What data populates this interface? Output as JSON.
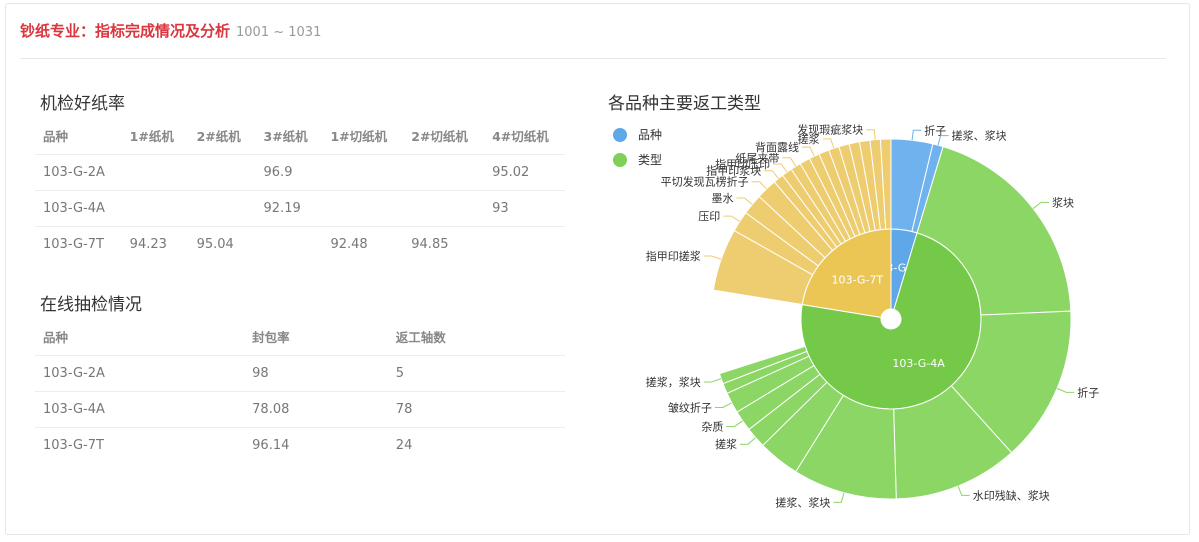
{
  "header": {
    "title": "钞纸专业：指标完成情况及分析",
    "range": "1001 ~ 1031"
  },
  "machine_table": {
    "title": "机检好纸率",
    "columns": [
      "品种",
      "1#纸机",
      "2#纸机",
      "3#纸机",
      "1#切纸机",
      "2#切纸机",
      "4#切纸机"
    ],
    "rows": [
      [
        "103-G-2A",
        "",
        "",
        "96.9",
        "",
        "",
        "95.02"
      ],
      [
        "103-G-4A",
        "",
        "",
        "92.19",
        "",
        "",
        "93"
      ],
      [
        "103-G-7T",
        "94.23",
        "95.04",
        "",
        "92.48",
        "94.85",
        ""
      ]
    ]
  },
  "online_table": {
    "title": "在线抽检情况",
    "columns": [
      "品种",
      "封包率",
      "返工轴数"
    ],
    "rows": [
      [
        "103-G-2A",
        "98",
        "5"
      ],
      [
        "103-G-4A",
        "78.08",
        "78"
      ],
      [
        "103-G-7T",
        "96.14",
        "24"
      ]
    ]
  },
  "chart": {
    "title": "各品种主要返工类型",
    "legend": [
      {
        "label": "品种",
        "color": "#5ea8ea"
      },
      {
        "label": "类型",
        "color": "#7ed05a"
      }
    ]
  },
  "chart_data": {
    "type": "sunburst",
    "title": "各品种主要返工类型",
    "rings": [
      {
        "name": "103-G-2A",
        "value": 5,
        "color": "#5ea8ea",
        "childColor": "#6fb2ee",
        "children": [
          {
            "name": "折子",
            "value": 4
          },
          {
            "name": "搓浆、浆块",
            "value": 1
          }
        ]
      },
      {
        "name": "103-G-4A",
        "value": 78,
        "color": "#74c948",
        "childColor": "#8cd665",
        "children": [
          {
            "name": "浆块",
            "value": 21
          },
          {
            "name": "折子",
            "value": 15
          },
          {
            "name": "水印残缺、浆块",
            "value": 12
          },
          {
            "name": "搓浆、浆块",
            "value": 10
          },
          {
            "name": "",
            "value": 4
          },
          {
            "name": "搓浆",
            "value": 2
          },
          {
            "name": "杂质",
            "value": 2
          },
          {
            "name": "皱纹折子",
            "value": 2
          },
          {
            "name": "",
            "value": 1
          },
          {
            "name": "搓浆，浆块",
            "value": 1
          }
        ]
      },
      {
        "name": "103-G-7T",
        "value": 24,
        "color": "#ecc655",
        "childColor": "#eecd70",
        "children": [
          {
            "name": "指甲印搓浆",
            "value": 6
          },
          {
            "name": "压印",
            "value": 2
          },
          {
            "name": "墨水",
            "value": 2
          },
          {
            "name": "平切发现瓦楞折子",
            "value": 2
          },
          {
            "name": "指甲印浆块",
            "value": 1
          },
          {
            "name": "指甲印压印",
            "value": 1
          },
          {
            "name": "纸尾夹带",
            "value": 1
          },
          {
            "name": "",
            "value": 1
          },
          {
            "name": "背面露线",
            "value": 1
          },
          {
            "name": "",
            "value": 1
          },
          {
            "name": "搓浆",
            "value": 1
          },
          {
            "name": "",
            "value": 1
          },
          {
            "name": "",
            "value": 1
          },
          {
            "name": "",
            "value": 1
          },
          {
            "name": "发现瑕疵浆块",
            "value": 1
          },
          {
            "name": "",
            "value": 1
          }
        ]
      }
    ]
  }
}
